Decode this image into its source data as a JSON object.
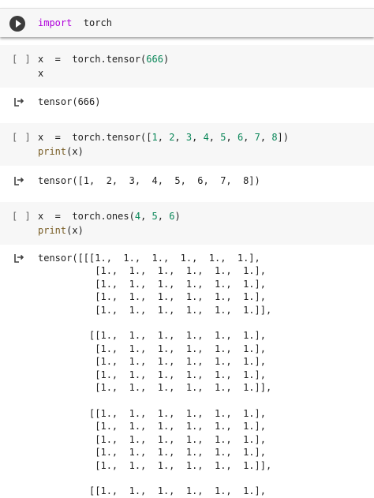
{
  "cells": [
    {
      "id": "cell1",
      "bracket": "",
      "code": [
        [
          {
            "t": "import",
            "c": "kw"
          },
          {
            "t": "  torch",
            "c": ""
          }
        ]
      ]
    },
    {
      "id": "cell2",
      "bracket": "[ ]",
      "code": [
        [
          {
            "t": "x  =  torch.tensor(",
            "c": ""
          },
          {
            "t": "666",
            "c": "num"
          },
          {
            "t": ")",
            "c": ""
          }
        ],
        [
          {
            "t": "x",
            "c": ""
          }
        ]
      ],
      "output": [
        "tensor(666)"
      ]
    },
    {
      "id": "cell3",
      "bracket": "[ ]",
      "code": [
        [
          {
            "t": "x  =  torch.tensor([",
            "c": ""
          },
          {
            "t": "1",
            "c": "num"
          },
          {
            "t": ", ",
            "c": ""
          },
          {
            "t": "2",
            "c": "num"
          },
          {
            "t": ", ",
            "c": ""
          },
          {
            "t": "3",
            "c": "num"
          },
          {
            "t": ", ",
            "c": ""
          },
          {
            "t": "4",
            "c": "num"
          },
          {
            "t": ", ",
            "c": ""
          },
          {
            "t": "5",
            "c": "num"
          },
          {
            "t": ", ",
            "c": ""
          },
          {
            "t": "6",
            "c": "num"
          },
          {
            "t": ", ",
            "c": ""
          },
          {
            "t": "7",
            "c": "num"
          },
          {
            "t": ", ",
            "c": ""
          },
          {
            "t": "8",
            "c": "num"
          },
          {
            "t": "])",
            "c": ""
          }
        ],
        [
          {
            "t": "print",
            "c": "fn"
          },
          {
            "t": "(x)",
            "c": ""
          }
        ]
      ],
      "output": [
        "tensor([1,  2,  3,  4,  5,  6,  7,  8])"
      ]
    },
    {
      "id": "cell4",
      "bracket": "[ ]",
      "code": [
        [
          {
            "t": "x  =  torch.ones(",
            "c": ""
          },
          {
            "t": "4",
            "c": "num"
          },
          {
            "t": ", ",
            "c": ""
          },
          {
            "t": "5",
            "c": "num"
          },
          {
            "t": ", ",
            "c": ""
          },
          {
            "t": "6",
            "c": "num"
          },
          {
            "t": ")",
            "c": ""
          }
        ],
        [
          {
            "t": "print",
            "c": "fn"
          },
          {
            "t": "(x)",
            "c": ""
          }
        ]
      ],
      "output": [
        "tensor([[[1.,  1.,  1.,  1.,  1.,  1.],",
        "          [1.,  1.,  1.,  1.,  1.,  1.],",
        "          [1.,  1.,  1.,  1.,  1.,  1.],",
        "          [1.,  1.,  1.,  1.,  1.,  1.],",
        "          [1.,  1.,  1.,  1.,  1.,  1.]],",
        "",
        "         [[1.,  1.,  1.,  1.,  1.,  1.],",
        "          [1.,  1.,  1.,  1.,  1.,  1.],",
        "          [1.,  1.,  1.,  1.,  1.,  1.],",
        "          [1.,  1.,  1.,  1.,  1.,  1.],",
        "          [1.,  1.,  1.,  1.,  1.,  1.]],",
        "",
        "         [[1.,  1.,  1.,  1.,  1.,  1.],",
        "          [1.,  1.,  1.,  1.,  1.,  1.],",
        "          [1.,  1.,  1.,  1.,  1.,  1.],",
        "          [1.,  1.,  1.,  1.,  1.,  1.],",
        "          [1.,  1.,  1.,  1.,  1.,  1.]],",
        "",
        "         [[1.,  1.,  1.,  1.,  1.,  1.],"
      ]
    }
  ],
  "icons": {
    "run": "play-icon",
    "output": "output-arrow-icon"
  },
  "colors": {
    "keyword": "#af00db",
    "number": "#098658",
    "function": "#795e26",
    "cell_bg": "#f7f7f7",
    "run_button": "#3c3c3c"
  }
}
